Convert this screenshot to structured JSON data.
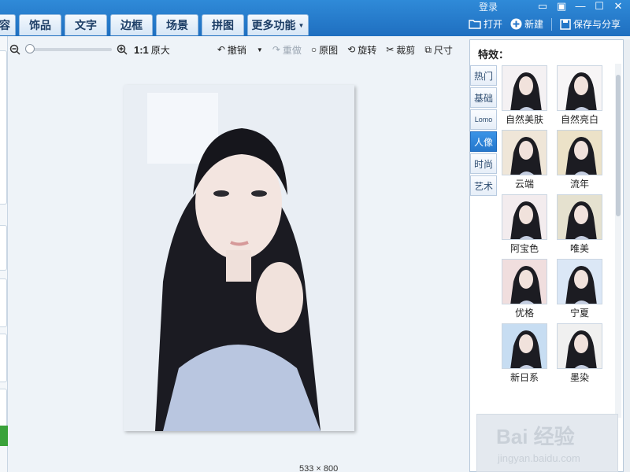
{
  "header": {
    "tabs": [
      {
        "label": "容",
        "partial": true
      },
      {
        "label": "饰品"
      },
      {
        "label": "文字"
      },
      {
        "label": "边框"
      },
      {
        "label": "场景"
      },
      {
        "label": "拼图"
      },
      {
        "label": "更多功能",
        "dropdown": true
      }
    ],
    "login_label": "登录",
    "actions": [
      {
        "label": "打开",
        "icon": "folder-icon"
      },
      {
        "label": "新建",
        "icon": "plus-circle-icon"
      },
      {
        "label": "保存与分享",
        "icon": "save-icon"
      }
    ]
  },
  "toolbar": {
    "zoom_out_icon": "zoom-out-icon",
    "zoom_in_icon": "zoom-in-icon",
    "zoom_level": 0.0,
    "one_to_one_label": "1:1",
    "original_size_label": "原大",
    "undo_label": "撤销",
    "redo_label": "重做",
    "original_label": "原图",
    "rotate_label": "旋转",
    "crop_label": "裁剪",
    "size_label": "尺寸"
  },
  "status": {
    "dimensions": "533 × 800"
  },
  "effects_panel": {
    "title": "特效：",
    "categories": [
      {
        "label": "热门"
      },
      {
        "label": "基础"
      },
      {
        "label": "Lomo"
      },
      {
        "label": "人像",
        "active": true
      },
      {
        "label": "时尚"
      },
      {
        "label": "艺术"
      }
    ],
    "thumbnails": [
      {
        "label": "自然美肤",
        "tint": "#f4f1f3"
      },
      {
        "label": "自然亮白",
        "tint": "#f7f5f6"
      },
      {
        "label": "云端",
        "tint": "#efe6d8"
      },
      {
        "label": "流年",
        "tint": "#ece2c8"
      },
      {
        "label": "阿宝色",
        "tint": "#f3ecee"
      },
      {
        "label": "唯美",
        "tint": "#e5e1cf"
      },
      {
        "label": "优格",
        "tint": "#f0dede"
      },
      {
        "label": "宁夏",
        "tint": "#dbe7f6"
      },
      {
        "label": "新日系",
        "tint": "#c7ddf2"
      },
      {
        "label": "墨染",
        "tint": "#f0f0f0"
      }
    ],
    "watermark_text": "Bai 经验",
    "watermark_sub": "jingyan.baidu.com"
  },
  "colors": {
    "topbar": "#2676c9",
    "accent": "#2577cc",
    "background": "#eef3f8"
  }
}
